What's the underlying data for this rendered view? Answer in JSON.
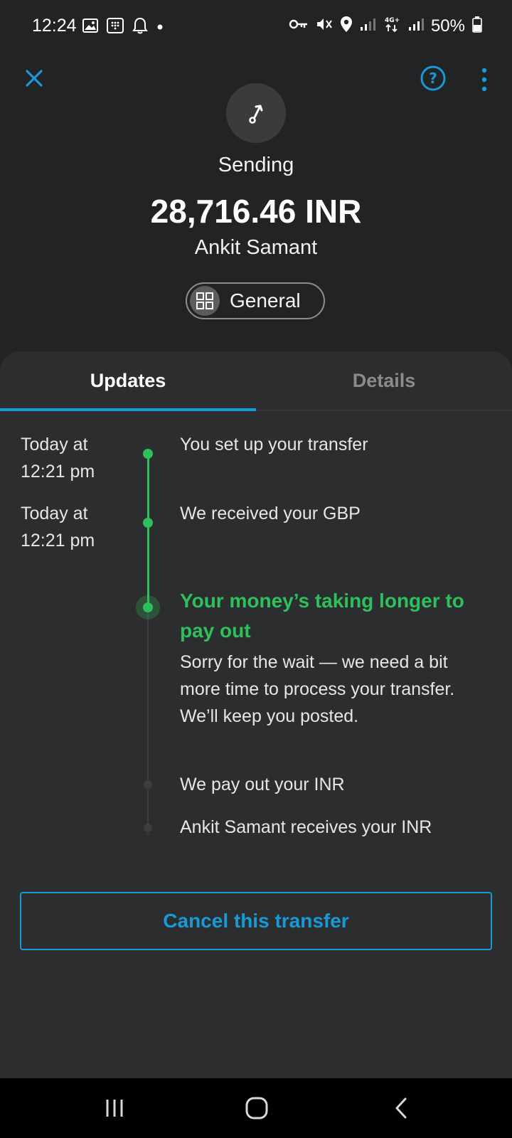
{
  "status_bar": {
    "time": "12:24",
    "battery": "50%",
    "left_icons": [
      "image-icon",
      "keypad-icon",
      "bell-icon",
      "dot-icon"
    ],
    "right_icons": [
      "key-icon",
      "mute-icon",
      "location-icon",
      "signal-icon",
      "network-4g-icon",
      "signal-icon",
      "battery-icon"
    ]
  },
  "header": {
    "close_icon": "close-icon",
    "help_icon": "help-icon",
    "more_icon": "more-vertical-icon",
    "status_icon": "send-arrow-icon",
    "status": "Sending",
    "amount": "28,716.46 INR",
    "recipient": "Ankit Samant",
    "category": "General",
    "category_icon": "grid-icon"
  },
  "tabs": [
    {
      "label": "Updates",
      "active": true
    },
    {
      "label": "Details",
      "active": false
    }
  ],
  "timeline": [
    {
      "time": "Today at 12:21 pm",
      "text": "You set up your transfer",
      "state": "done"
    },
    {
      "time": "Today at 12:21 pm",
      "text": "We received your GBP",
      "state": "done"
    },
    {
      "time": "",
      "title": "Your money’s taking longer to pay out",
      "text": "Sorry for the wait — we need a bit more time to process your transfer. We’ll keep you posted.",
      "state": "current"
    },
    {
      "time": "",
      "text": "We pay out your INR",
      "state": "pending"
    },
    {
      "time": "",
      "text": "Ankit Samant receives your INR",
      "state": "pending"
    }
  ],
  "actions": {
    "cancel_label": "Cancel this transfer"
  },
  "nav_bar": {
    "buttons": [
      "recent-apps-icon",
      "home-icon",
      "back-icon"
    ]
  },
  "colors": {
    "accent_blue": "#179ad6",
    "success_green": "#2ec05c",
    "background": "#222324",
    "card": "#2c2d2e"
  }
}
